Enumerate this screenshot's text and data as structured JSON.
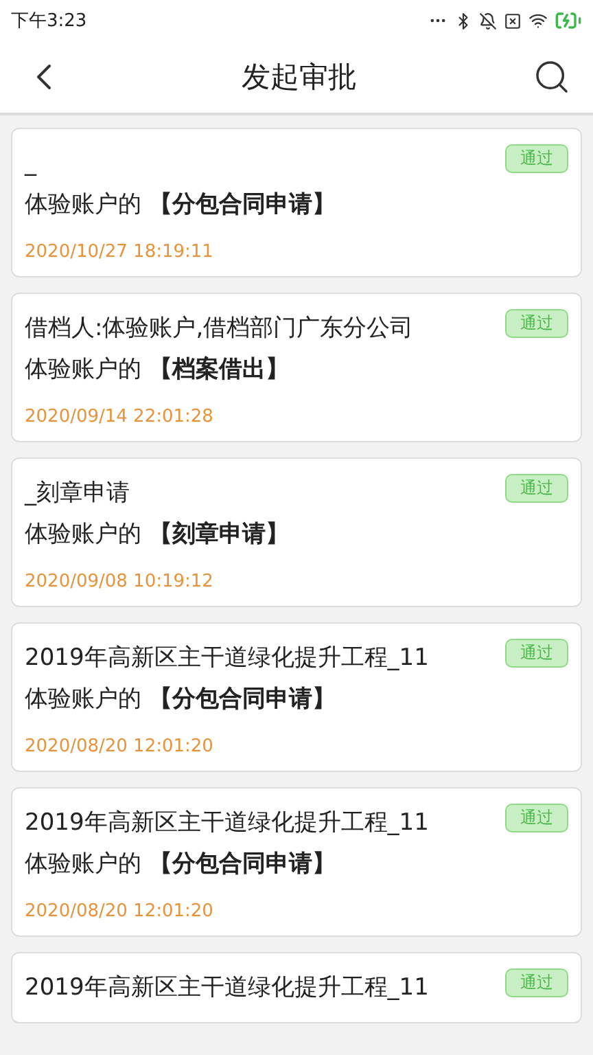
{
  "status_bar": {
    "time": "下午3:23"
  },
  "header": {
    "title": "发起审批"
  },
  "items": [
    {
      "title": "_",
      "applicant": "体验账户的",
      "form": "【分包合同申请】",
      "time": "2020/10/27 18:19:11",
      "status": "通过"
    },
    {
      "title": "借档人:体验账户,借档部门广东分公司",
      "applicant": "体验账户的",
      "form": "【档案借出】",
      "time": "2020/09/14 22:01:28",
      "status": "通过"
    },
    {
      "title": "_刻章申请",
      "applicant": "体验账户的",
      "form": "【刻章申请】",
      "time": "2020/09/08 10:19:12",
      "status": "通过"
    },
    {
      "title": "2019年高新区主干道绿化提升工程_11",
      "applicant": "体验账户的",
      "form": "【分包合同申请】",
      "time": "2020/08/20 12:01:20",
      "status": "通过"
    },
    {
      "title": "2019年高新区主干道绿化提升工程_11",
      "applicant": "体验账户的",
      "form": "【分包合同申请】",
      "time": "2020/08/20 12:01:20",
      "status": "通过"
    },
    {
      "title": "2019年高新区主干道绿化提升工程_11",
      "status": "通过"
    }
  ]
}
